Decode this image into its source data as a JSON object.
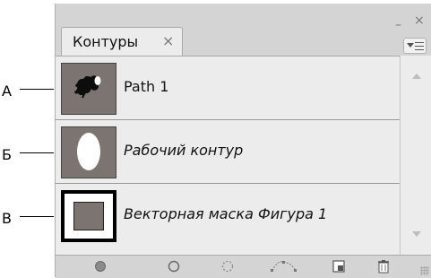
{
  "callouts": [
    "А",
    "Б",
    "В"
  ],
  "panel": {
    "tab_label": "Контуры",
    "tab_close_glyph": "×",
    "minimize_glyph": "–",
    "close_glyph": "×"
  },
  "paths": [
    {
      "name": "Path 1",
      "style": "normal",
      "thumbnail": "figure-thumbnail"
    },
    {
      "name": "Рабочий контур",
      "style": "italic",
      "thumbnail": "white-ellipse-thumbnail"
    },
    {
      "name": "Векторная маска Фигура 1",
      "style": "italic",
      "thumbnail": "vector-mask-thumbnail"
    }
  ],
  "toolbar": [
    "fill-path-icon",
    "stroke-path-icon",
    "load-as-selection-icon",
    "make-work-path-icon",
    "new-path-icon",
    "delete-path-icon"
  ],
  "colors": {
    "panel_bg": "#d4d4d4",
    "list_bg": "#ececec",
    "thumb_gray": "#7c7470"
  }
}
